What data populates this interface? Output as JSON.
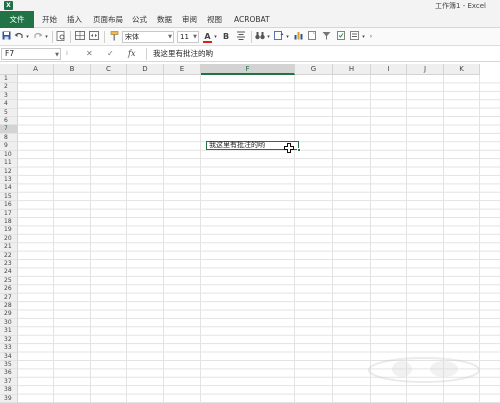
{
  "window": {
    "title": "工作簿1 - Excel",
    "app_icon": "X"
  },
  "ribbon": {
    "tabs": [
      "文件",
      "开始",
      "插入",
      "页面布局",
      "公式",
      "数据",
      "审阅",
      "视图",
      "ACROBAT"
    ]
  },
  "toolbar": {
    "font_name": "宋体",
    "font_size": "11",
    "bold_label": "B",
    "font_color_label": "A",
    "font_color": "#e02020"
  },
  "formula_bar": {
    "name_box": "F7",
    "fx_label": "fx",
    "cancel_label": "✕",
    "enter_label": "✓",
    "content": "我这里有批注的哟"
  },
  "grid": {
    "columns": [
      "A",
      "B",
      "C",
      "D",
      "E",
      "F",
      "G",
      "H",
      "I",
      "J",
      "K"
    ],
    "active_column": "F",
    "rows": [
      "1",
      "2",
      "3",
      "4",
      "5",
      "6",
      "7",
      "8",
      "9",
      "10",
      "11",
      "12",
      "13",
      "14",
      "15",
      "16",
      "17",
      "18",
      "19",
      "20",
      "21",
      "22",
      "23",
      "24",
      "25",
      "26",
      "27",
      "28",
      "29",
      "30",
      "31",
      "32",
      "33",
      "34",
      "35",
      "36",
      "37",
      "38",
      "39"
    ],
    "active_row": "7",
    "active_cell_value": "我这里有批注的哟",
    "accent_color": "#217346"
  }
}
